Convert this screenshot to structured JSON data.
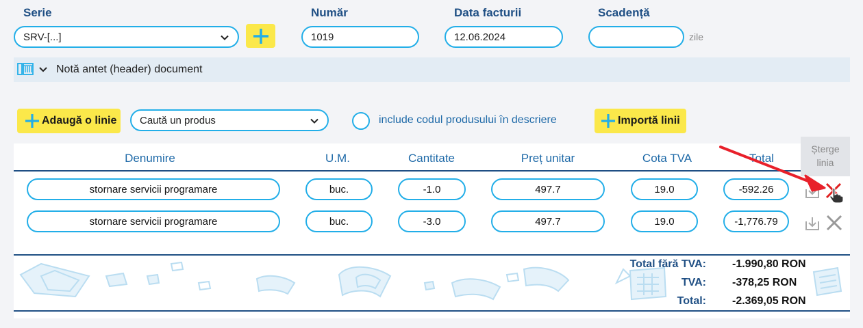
{
  "form": {
    "serie": {
      "label": "Serie",
      "value": "SRV-[...]"
    },
    "numar": {
      "label": "Număr",
      "value": "1019"
    },
    "data": {
      "label": "Data facturii",
      "value": "12.06.2024"
    },
    "scadenta": {
      "label": "Scadență",
      "value": "",
      "suffix": "zile"
    }
  },
  "header_section": {
    "label": "Notă antet (header) document"
  },
  "toolbar": {
    "add_line_label": "Adaugă o linie",
    "search_product_value": "Caută un produs",
    "include_code_label": "include codul produsului în descriere",
    "import_lines_label": "Importă linii"
  },
  "table": {
    "columns": [
      "Denumire",
      "U.M.",
      "Cantitate",
      "Preț unitar",
      "Cota TVA",
      "Total"
    ],
    "rows": [
      {
        "denumire": "stornare servicii programare",
        "um": "buc.",
        "cantitate": "-1.0",
        "pret": "497.7",
        "tva": "19.0",
        "total": "-592.26"
      },
      {
        "denumire": "stornare servicii programare",
        "um": "buc.",
        "cantitate": "-3.0",
        "pret": "497.7",
        "tva": "19.0",
        "total": "-1,776.79"
      }
    ],
    "tooltip": "Șterge linia"
  },
  "totals": {
    "fara_tva_label": "Total fără TVA:",
    "fara_tva_value": "-1.990,80 RON",
    "tva_label": "TVA:",
    "tva_value": "-378,25 RON",
    "total_label": "Total:",
    "total_value": "-2.369,05 RON"
  },
  "colors": {
    "accent": "#22aee8",
    "label": "#1f4f84",
    "button": "#fbe84a",
    "delete_active": "#e02020",
    "arrow": "#e8202a"
  }
}
